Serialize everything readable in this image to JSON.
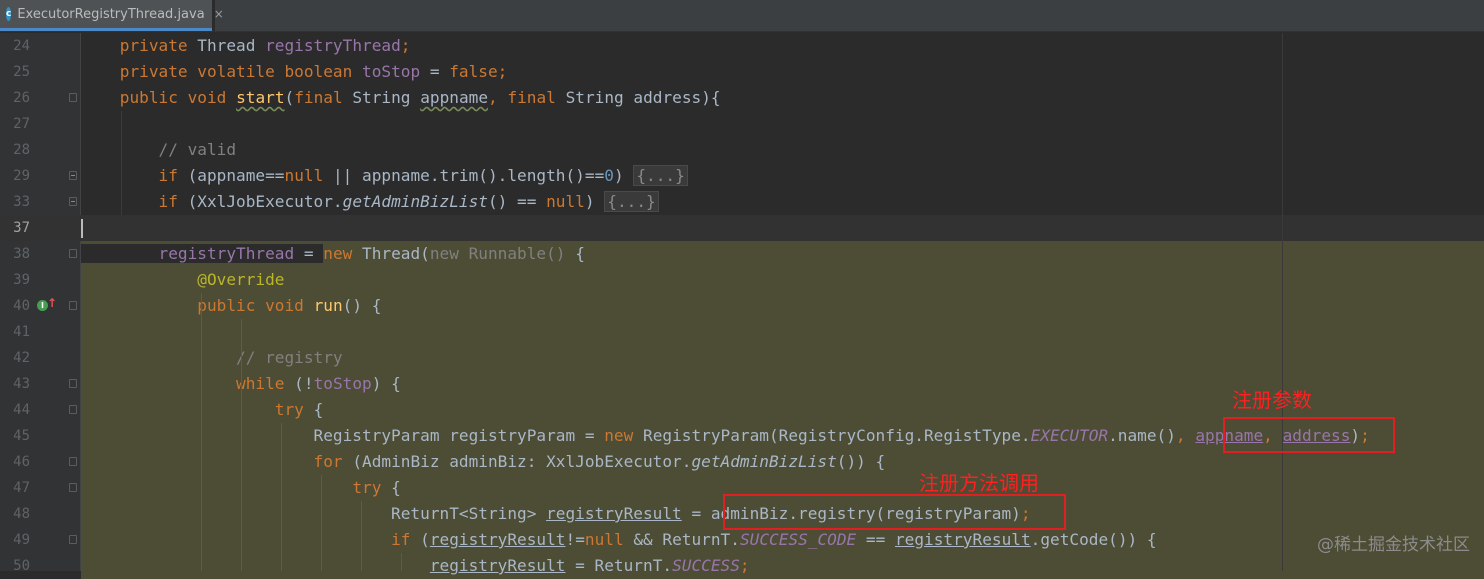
{
  "tab": {
    "icon": "java-class-icon",
    "icon_letter": "c",
    "label": "ExecutorRegistryThread.java",
    "close": "×"
  },
  "annotations": {
    "register_params": "注册参数",
    "register_call": "注册方法调用"
  },
  "watermark": "@稀土掘金技术社区",
  "code": {
    "line_numbers": [
      "24",
      "25",
      "26",
      "27",
      "28",
      "29",
      "33",
      "37",
      "38",
      "39",
      "40",
      "41",
      "42",
      "43",
      "44",
      "45",
      "46",
      "47",
      "48",
      "49",
      "50"
    ]
  }
}
